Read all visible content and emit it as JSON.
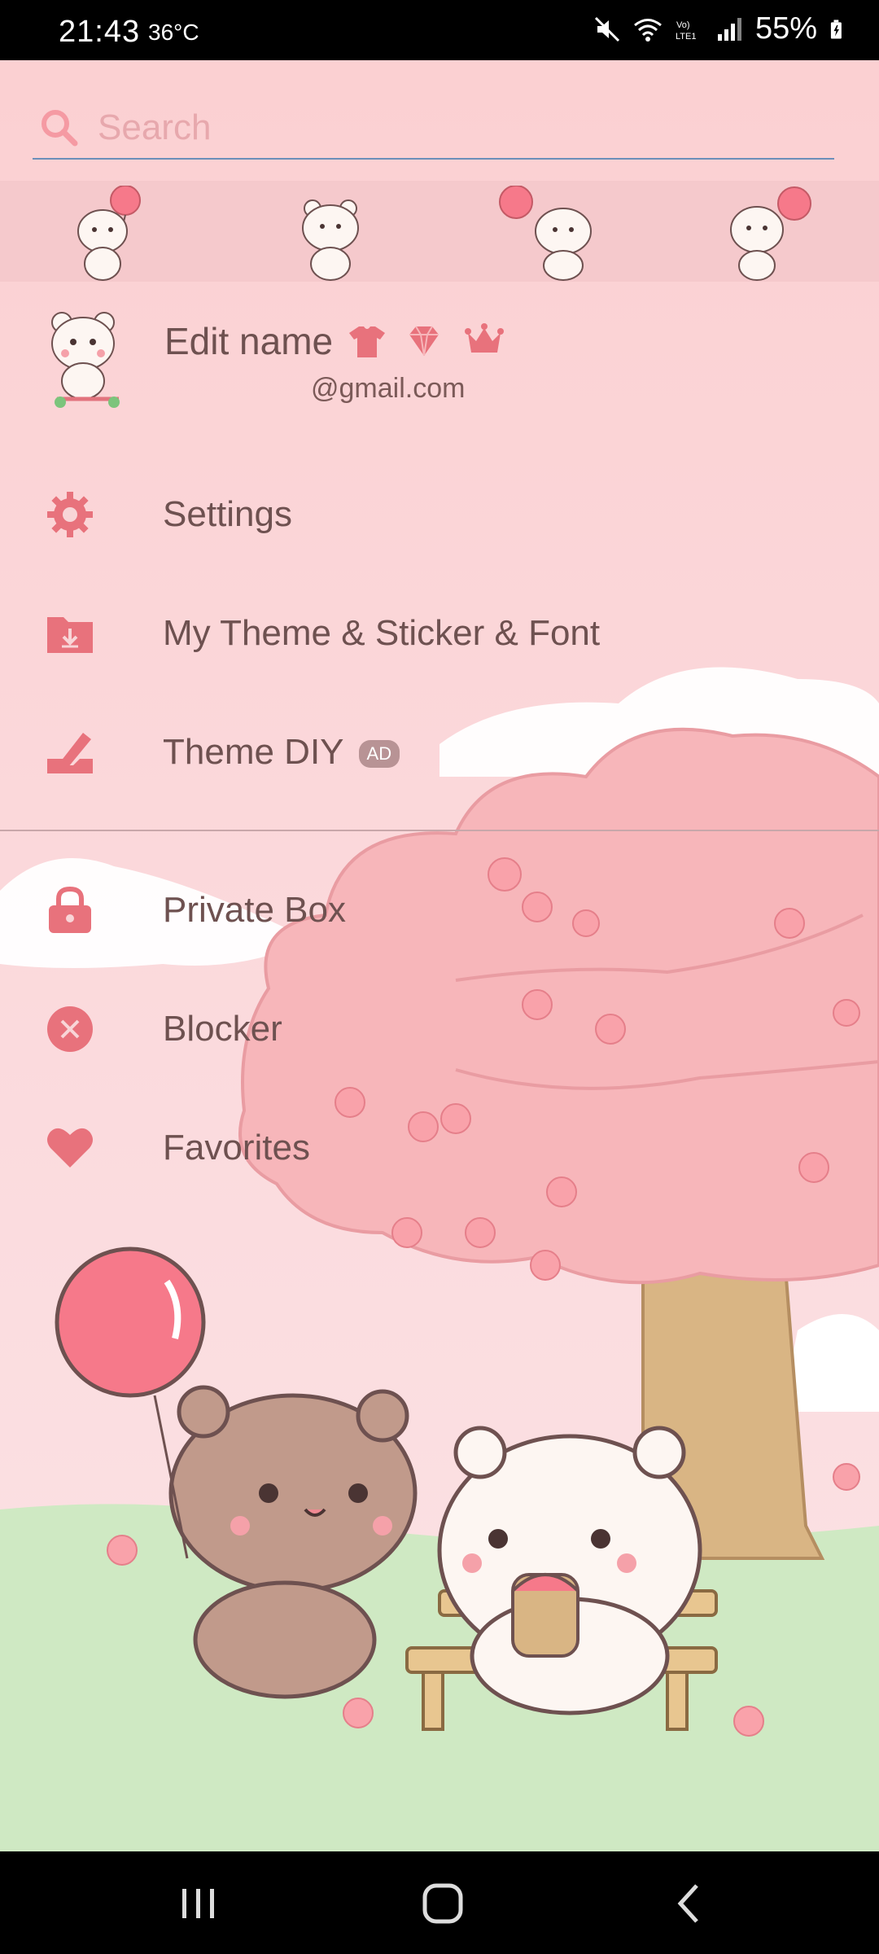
{
  "status_bar": {
    "time": "21:43",
    "temperature": "36°C",
    "battery": "55%"
  },
  "search": {
    "placeholder": "Search"
  },
  "profile": {
    "name": "Edit name",
    "email": "@gmail.com",
    "badges": [
      "shirt-icon",
      "diamond-icon",
      "crown-icon"
    ]
  },
  "menu": {
    "settings": "Settings",
    "my_theme": "My Theme & Sticker & Font",
    "theme_diy": "Theme DIY",
    "theme_diy_badge": "AD",
    "private_box": "Private Box",
    "blocker": "Blocker",
    "favorites": "Favorites"
  },
  "colors": {
    "accent": "#e86e7a",
    "text": "#6e5150",
    "background": "#f8d5d7"
  }
}
